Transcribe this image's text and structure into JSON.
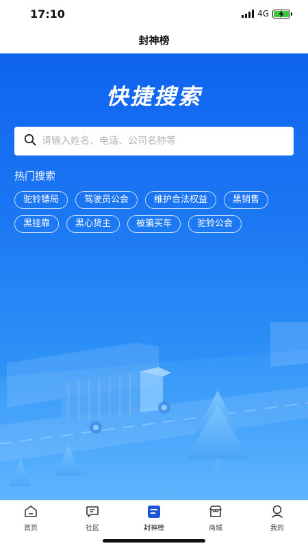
{
  "status_bar": {
    "time": "17:10",
    "network": "4G"
  },
  "nav": {
    "title": "封神榜"
  },
  "hero": {
    "title": "快捷搜索"
  },
  "search": {
    "placeholder": "请输入姓名、电话、公司名称等",
    "value": ""
  },
  "hot": {
    "title": "热门搜索",
    "tags": [
      "驼铃镖局",
      "驾驶员公会",
      "维护合法权益",
      "黑销售",
      "黑挂靠",
      "黑心货主",
      "被骗买车",
      "驼铃公会"
    ]
  },
  "tab_bar": {
    "items": [
      {
        "label": "首页",
        "icon": "home-icon",
        "active": false
      },
      {
        "label": "社区",
        "icon": "chat-icon",
        "active": false
      },
      {
        "label": "封神榜",
        "icon": "list-icon",
        "active": true
      },
      {
        "label": "商城",
        "icon": "shop-icon",
        "active": false
      },
      {
        "label": "我的",
        "icon": "profile-icon",
        "active": false
      }
    ]
  },
  "colors": {
    "hero_top": "#0f63ee",
    "hero_bottom": "#3aa0fb",
    "active_tab": "#1a56d6",
    "battery": "#3ec93e"
  }
}
